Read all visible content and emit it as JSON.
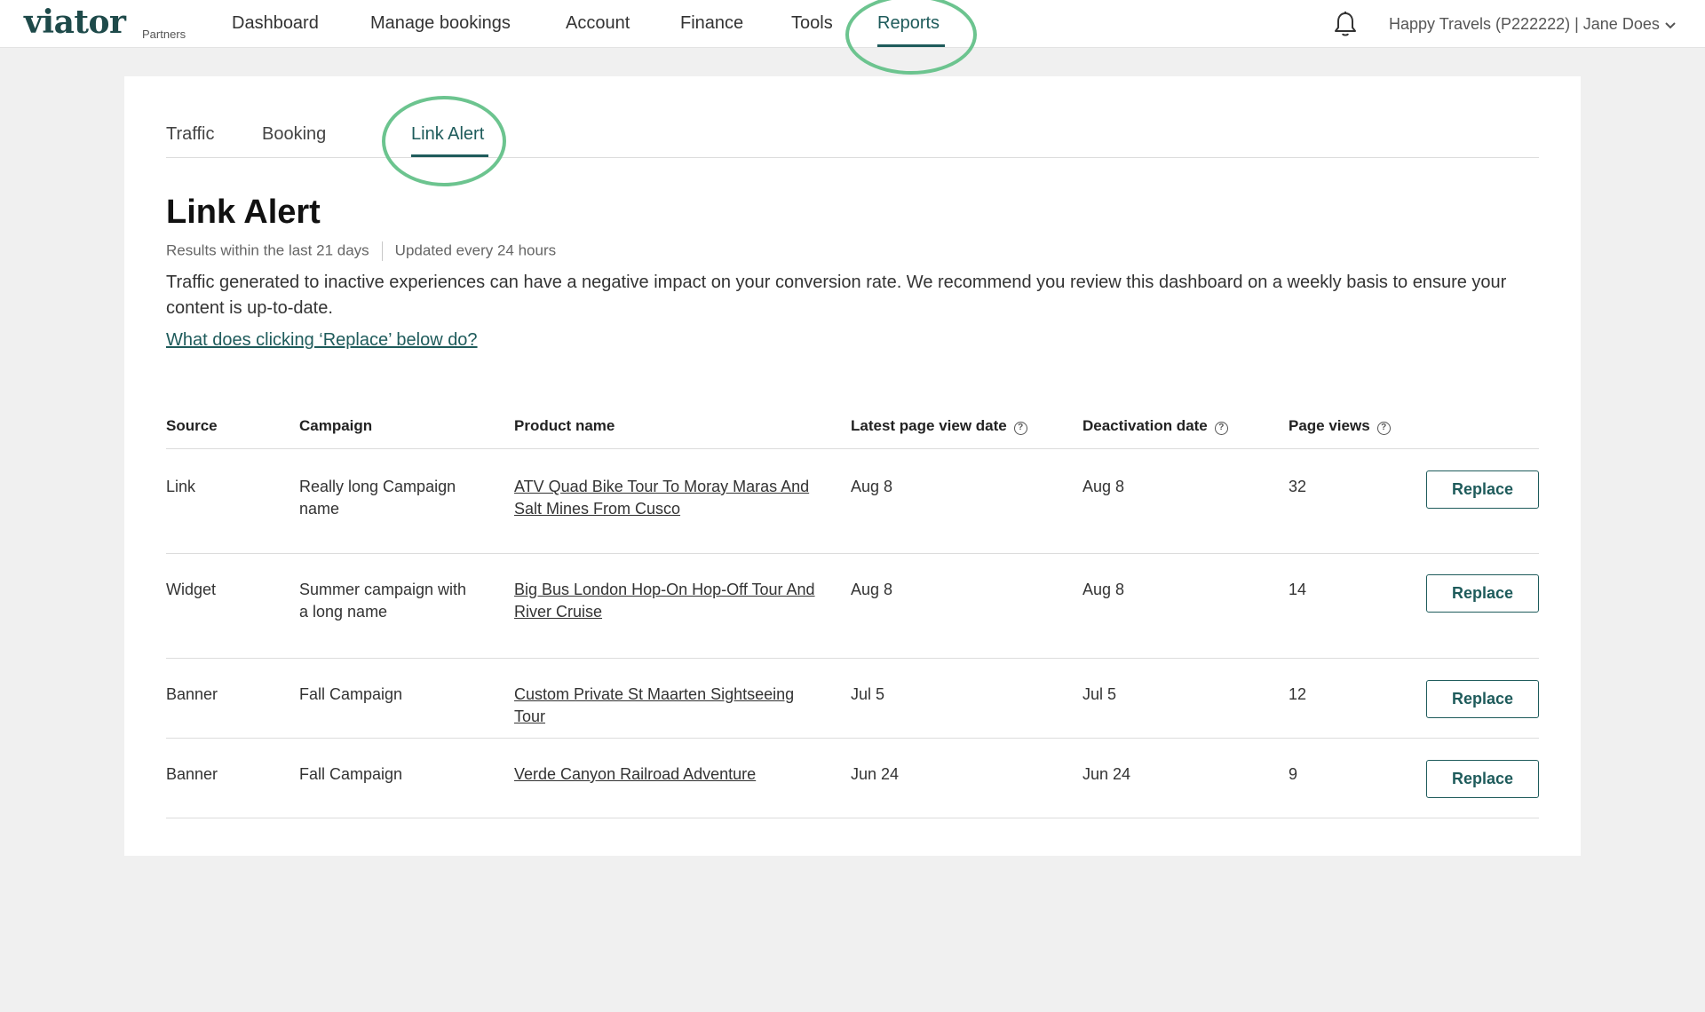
{
  "app": {
    "logo": "viator",
    "logo_sub": "Partners"
  },
  "nav": {
    "items": [
      {
        "label": "Dashboard"
      },
      {
        "label": "Manage bookings"
      },
      {
        "label": "Account"
      },
      {
        "label": "Finance"
      },
      {
        "label": "Tools"
      },
      {
        "label": "Reports",
        "active": true
      }
    ],
    "account_label": "Happy Travels (P222222)  |  Jane Does"
  },
  "tabs": [
    {
      "label": "Traffic"
    },
    {
      "label": "Booking"
    },
    {
      "label": "Link Alert",
      "active": true
    }
  ],
  "page": {
    "title": "Link Alert",
    "meta_results": "Results within the last 21 days",
    "meta_updated": "Updated every 24 hours",
    "description": "Traffic generated to inactive experiences can have a negative impact on your conversion rate. We recommend you review this dashboard on a weekly basis to ensure your content is up-to-date.",
    "help_link": "What does clicking ‘Replace’ below do?"
  },
  "table": {
    "headers": {
      "source": "Source",
      "campaign": "Campaign",
      "product": "Product name",
      "latest": "Latest page view date",
      "deactivation": "Deactivation date",
      "views": "Page views"
    },
    "rows": [
      {
        "source": "Link",
        "campaign": "Really long Campaign name",
        "product": "ATV Quad Bike Tour To Moray Maras And Salt Mines From Cusco",
        "latest": "Aug 8",
        "deactivation": "Aug 8",
        "views": "32",
        "action": "Replace"
      },
      {
        "source": "Widget",
        "campaign": "Summer campaign with a long name",
        "product": "Big Bus London Hop-On Hop-Off Tour And River Cruise",
        "latest": "Aug 8",
        "deactivation": "Aug 8",
        "views": "14",
        "action": "Replace"
      },
      {
        "source": "Banner",
        "campaign": "Fall Campaign",
        "product": "Custom Private St Maarten Sightseeing Tour",
        "latest": "Jul 5",
        "deactivation": "Jul 5",
        "views": "12",
        "action": "Replace"
      },
      {
        "source": "Banner",
        "campaign": "Fall Campaign",
        "product": "Verde Canyon Railroad Adventure",
        "latest": "Jun 24",
        "deactivation": "Jun 24",
        "views": "9",
        "action": "Replace"
      }
    ]
  },
  "colors": {
    "brand": "#1e5b5b",
    "highlight": "#6cc48f",
    "background": "#f0f0f0"
  }
}
